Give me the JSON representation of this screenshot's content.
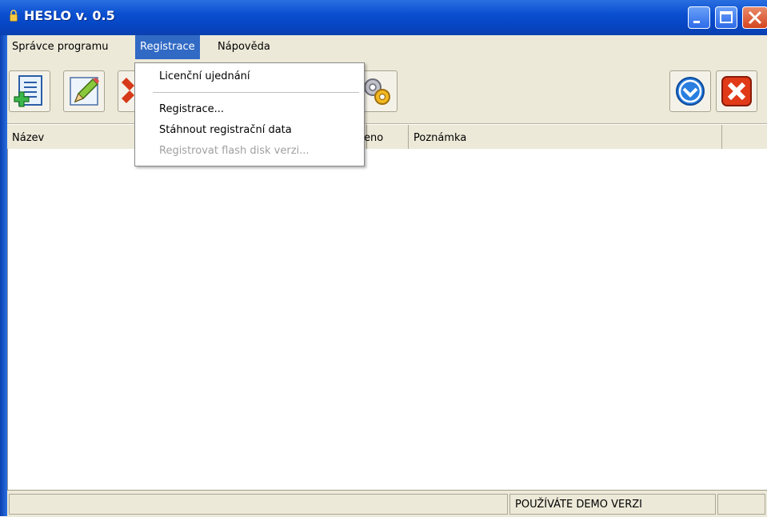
{
  "window": {
    "title": "HESLO v. 0.5"
  },
  "menubar": {
    "items": [
      {
        "label": "Správce programu"
      },
      {
        "label": "Registrace"
      },
      {
        "label": "Nápověda"
      }
    ]
  },
  "dropdown": {
    "items": [
      {
        "label": "Licenční ujednání",
        "enabled": true
      },
      {
        "label": "Registrace...",
        "enabled": true
      },
      {
        "label": "Stáhnout registrační data",
        "enabled": true
      },
      {
        "label": "Registrovat flash disk verzi...",
        "enabled": false
      }
    ]
  },
  "toolbar": {
    "left_icons": [
      "add-record-icon",
      "edit-record-icon",
      "delete-record-icon",
      "settings-icon"
    ],
    "right_icons": [
      "download-icon",
      "exit-icon"
    ]
  },
  "grid": {
    "columns": [
      {
        "label": "Název"
      },
      {
        "label": ""
      },
      {
        "label": "eno"
      },
      {
        "label": "Poznámka"
      },
      {
        "label": ""
      }
    ]
  },
  "statusbar": {
    "panels": [
      {
        "text": ""
      },
      {
        "text": "POUŽÍVÁTE DEMO VERZI"
      },
      {
        "text": ""
      }
    ]
  },
  "colors": {
    "titlebar": "#0646c4",
    "menu_highlight": "#316ac5",
    "chrome": "#ece9d8",
    "close_button": "#d4451f"
  }
}
